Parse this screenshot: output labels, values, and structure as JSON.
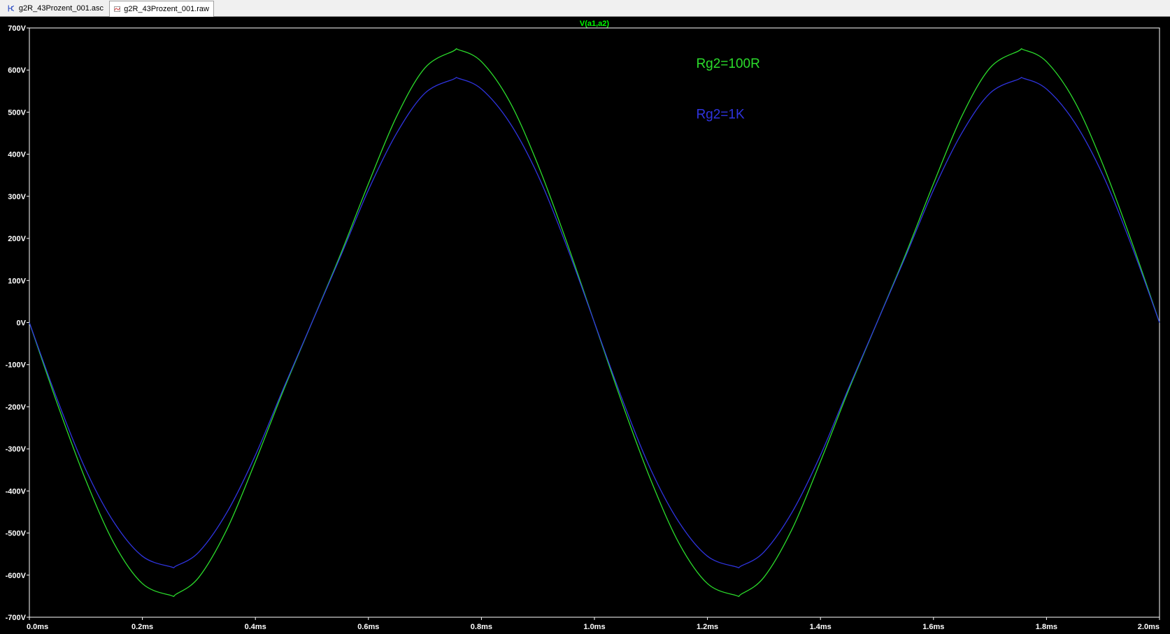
{
  "tabs": [
    {
      "label": "g2R_43Prozent_001.asc",
      "icon": "schematic-icon"
    },
    {
      "label": "g2R_43Prozent_001.raw",
      "icon": "waveform-icon"
    }
  ],
  "chart_data": {
    "type": "line",
    "title": "V(a1,a2)",
    "xlabel": "",
    "ylabel": "",
    "xlim": [
      0.0,
      2.0
    ],
    "ylim": [
      -700,
      700
    ],
    "x_unit": "ms",
    "y_unit": "V",
    "xticks": [
      "0.0ms",
      "0.2ms",
      "0.4ms",
      "0.6ms",
      "0.8ms",
      "1.0ms",
      "1.2ms",
      "1.4ms",
      "1.6ms",
      "1.8ms",
      "2.0ms"
    ],
    "yticks": [
      "700V",
      "600V",
      "500V",
      "400V",
      "300V",
      "200V",
      "100V",
      "0V",
      "-100V",
      "-200V",
      "-300V",
      "-400V",
      "-500V",
      "-600V",
      "-700V"
    ],
    "grid": false,
    "colors": {
      "background": "#000000",
      "axis": "#ffffff",
      "title": "#00ff00"
    },
    "series": [
      {
        "name": "Rg2=100R",
        "color": "#2bdc2b",
        "x": [
          0.0,
          0.05,
          0.1,
          0.15,
          0.2,
          0.25,
          0.26,
          0.3,
          0.35,
          0.4,
          0.45,
          0.5,
          0.55,
          0.6,
          0.65,
          0.7,
          0.75,
          0.76,
          0.8,
          0.85,
          0.9,
          0.95,
          1.0,
          1.05,
          1.1,
          1.15,
          1.2,
          1.25,
          1.26,
          1.3,
          1.35,
          1.4,
          1.45,
          1.5,
          1.55,
          1.6,
          1.65,
          1.7,
          1.75,
          1.76,
          1.8,
          1.85,
          1.9,
          1.95,
          2.0
        ],
        "values": [
          0,
          -195,
          -375,
          -525,
          -620,
          -648,
          -645,
          -605,
          -490,
          -330,
          -160,
          0,
          160,
          330,
          490,
          605,
          645,
          648,
          620,
          525,
          375,
          195,
          0,
          -195,
          -375,
          -525,
          -620,
          -648,
          -645,
          -605,
          -490,
          -330,
          -160,
          0,
          160,
          330,
          490,
          605,
          645,
          648,
          620,
          525,
          375,
          195,
          0
        ]
      },
      {
        "name": "Rg2=1K",
        "color": "#2f34e0",
        "x": [
          0.0,
          0.05,
          0.1,
          0.15,
          0.2,
          0.25,
          0.26,
          0.3,
          0.35,
          0.4,
          0.45,
          0.5,
          0.55,
          0.6,
          0.65,
          0.7,
          0.75,
          0.76,
          0.8,
          0.85,
          0.9,
          0.95,
          1.0,
          1.05,
          1.1,
          1.15,
          1.2,
          1.25,
          1.26,
          1.3,
          1.35,
          1.4,
          1.45,
          1.5,
          1.55,
          1.6,
          1.65,
          1.7,
          1.75,
          1.76,
          1.8,
          1.85,
          1.9,
          1.95,
          2.0
        ],
        "values": [
          0,
          -185,
          -350,
          -475,
          -555,
          -580,
          -578,
          -545,
          -450,
          -315,
          -155,
          0,
          155,
          315,
          450,
          545,
          578,
          580,
          555,
          475,
          350,
          185,
          0,
          -185,
          -350,
          -475,
          -555,
          -580,
          -578,
          -545,
          -450,
          -315,
          -155,
          0,
          155,
          315,
          450,
          545,
          578,
          580,
          555,
          475,
          350,
          185,
          0
        ]
      }
    ],
    "annotations": [
      {
        "text": "Rg2=100R",
        "color": "#2bdc2b",
        "x": 1.18,
        "y": 605
      },
      {
        "text": "Rg2=1K",
        "color": "#2f34e0",
        "x": 1.18,
        "y": 485
      }
    ]
  }
}
